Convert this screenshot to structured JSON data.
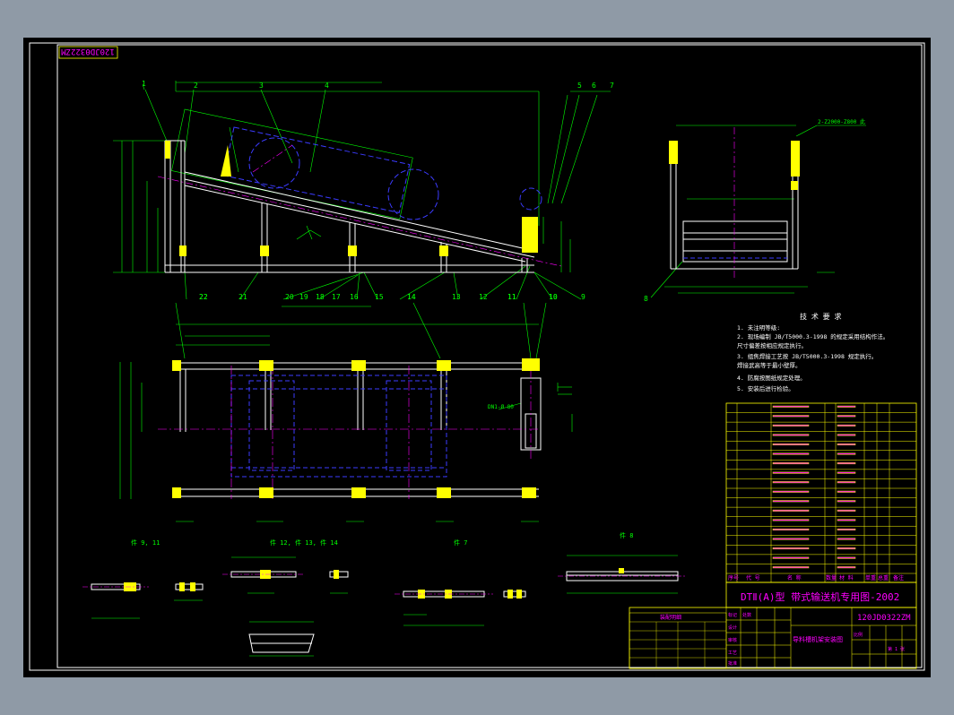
{
  "drawing": {
    "code_stamp": "120JD0322ZM",
    "section_title": "DTⅡ(A)型 带式输送机专用图-2002",
    "drawing_number": "120JD0322ZM",
    "drawing_name": "导料槽机架安装图",
    "tech_title": "技 术 要 求",
    "tech_notes": [
      "1. 未注明等级:",
      "2. 现场编制 JB/T5000.3-1998 的规定采用结构作法。",
      "   尺寸偏差按相应规定执行。",
      "3. 组焦焊接工艺按 JB/T5000.3-1998 规定执行。",
      "   焊接武高等于最小壁厚。",
      "4. 防腐按图纸规定处理。",
      "5. 安装后进行检验。"
    ],
    "view_labels": [
      "件 9, 11",
      "件 12, 件 13, 件 14",
      "件 7",
      "件 8"
    ],
    "callouts_top": [
      "1",
      "2",
      "3",
      "4",
      "5",
      "6",
      "7"
    ],
    "callouts_bottom": [
      "22",
      "21",
      "20",
      "19",
      "18",
      "17",
      "16",
      "15",
      "14",
      "13",
      "12",
      "11",
      "10",
      "9"
    ],
    "callouts_plan": [
      "22",
      "14",
      "11",
      "10"
    ],
    "side_callout": "8",
    "side_note": "2-Z2000-Z800 此",
    "detail_note": "DN1-Ø 80",
    "bom_header": [
      "序号",
      "代 号",
      "名 称",
      "数量",
      "材 料",
      "单重",
      "总重",
      "备注"
    ],
    "bom_rows_count": 18,
    "title_block_labels": {
      "mark": "标记",
      "count": "处数",
      "designer": "设计",
      "check": "审核",
      "process": "工艺",
      "approve": "批准",
      "scale": "比例",
      "sheet": "第 1 张"
    },
    "small_table_title": "装配明细"
  },
  "colors": {
    "background": "#000000",
    "frame": "#ffffff",
    "outline": "#ffffff",
    "dimension": "#00ff00",
    "hidden": "#3b3bff",
    "centerline": "#ff00ff",
    "text_table": "#ff00ff",
    "yellow": "#ffff00",
    "cyan": "#00ffff"
  }
}
